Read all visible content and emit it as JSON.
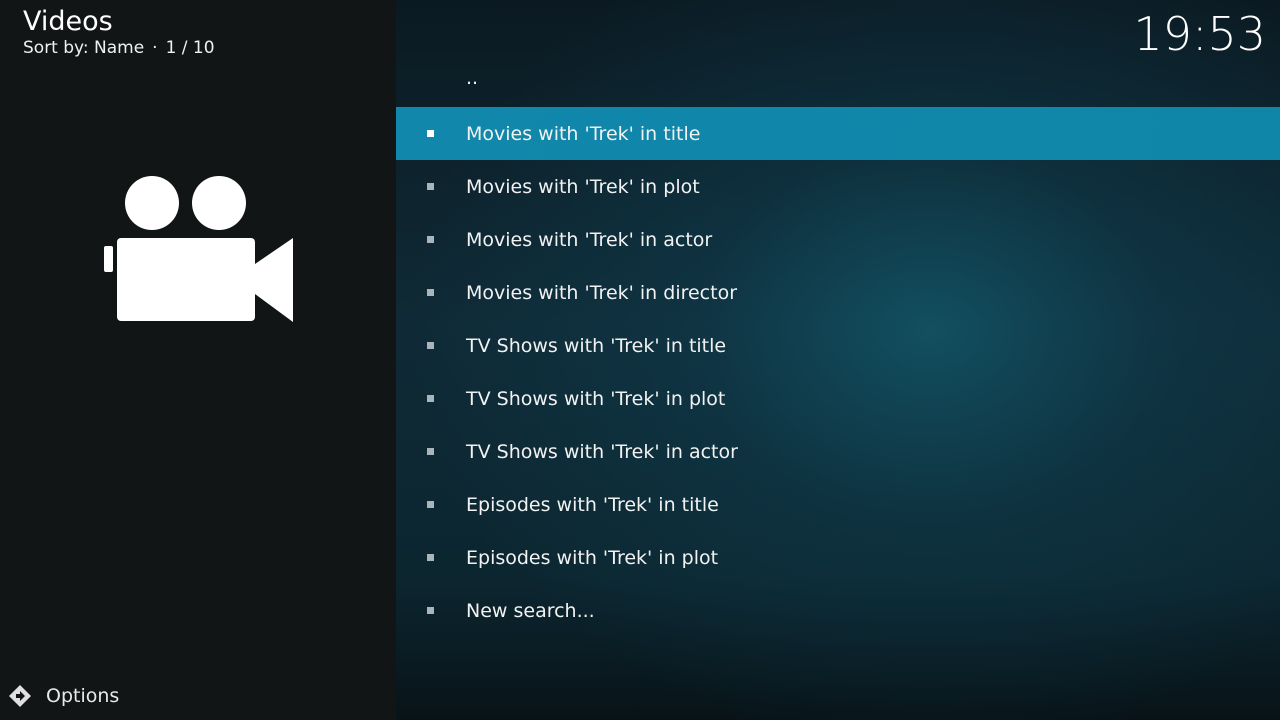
{
  "header": {
    "title": "Videos",
    "sort_label": "Sort by: Name",
    "separator": "·",
    "position": "1 / 10"
  },
  "clock": "19:53",
  "footer": {
    "options_label": "Options"
  },
  "list": {
    "parent_label": "..",
    "items": [
      {
        "label": "Movies with 'Trek' in title",
        "selected": true
      },
      {
        "label": "Movies with 'Trek' in plot",
        "selected": false
      },
      {
        "label": "Movies with 'Trek' in actor",
        "selected": false
      },
      {
        "label": "Movies with 'Trek' in director",
        "selected": false
      },
      {
        "label": "TV Shows with 'Trek' in title",
        "selected": false
      },
      {
        "label": "TV Shows with 'Trek' in plot",
        "selected": false
      },
      {
        "label": "TV Shows with 'Trek' in actor",
        "selected": false
      },
      {
        "label": "Episodes with 'Trek' in title",
        "selected": false
      },
      {
        "label": "Episodes with 'Trek' in plot",
        "selected": false
      },
      {
        "label": "New search...",
        "selected": false
      }
    ]
  },
  "icons": {
    "section_icon": "video-camera-icon",
    "options_icon": "options-arrow-icon",
    "list_bullet": "square-bullet-icon"
  },
  "colors": {
    "selection": "#1187a8",
    "left_panel": "#121516",
    "bullet": "#a8b6bb"
  }
}
